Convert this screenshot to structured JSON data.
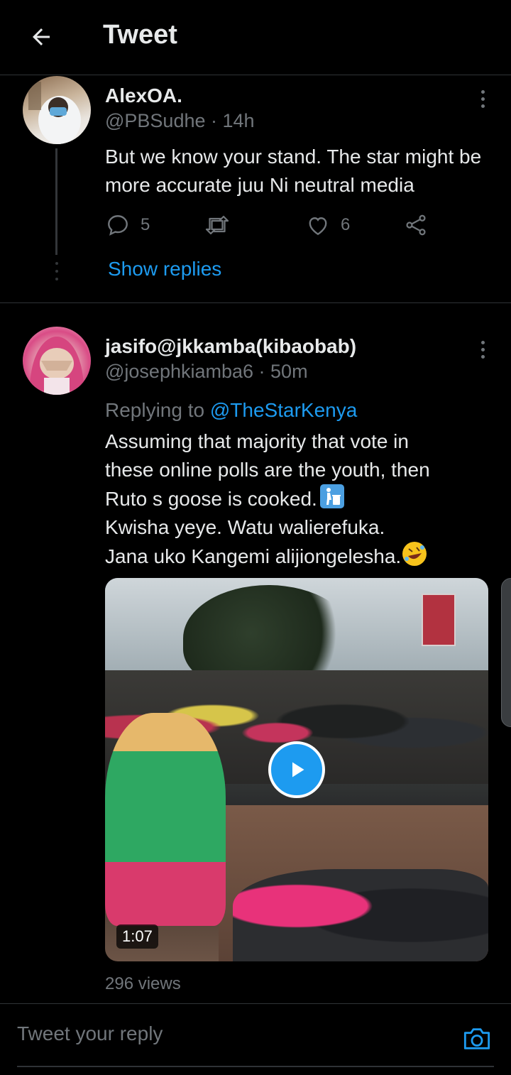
{
  "header": {
    "title": "Tweet",
    "back_icon": "arrow-left-icon"
  },
  "tweets": [
    {
      "name": "AlexOA.",
      "handle": "@PBSudhe",
      "time": "· 14h",
      "text": "But we know your stand. The star might be more accurate juu Ni neutral media",
      "stats": {
        "replies": "5",
        "retweets": "",
        "likes": "6"
      },
      "show_replies": "Show replies"
    },
    {
      "name": "jasifo@jkkamba(kibaobab)",
      "handle": "@josephkiamba6",
      "time": "· 50m",
      "replying_prefix": "Replying to ",
      "replying_to": "@TheStarKenya",
      "lines": [
        "Assuming that majority that vote in",
        "these online polls are the youth, then",
        "Ruto s goose is cooked.",
        "Kwisha yeye. Watu walierefuka.",
        "Jana uko Kangemi alijiongelesha."
      ],
      "emojis": [
        "put-litter-in-its-place-emoji",
        "rolling-on-floor-laughing-emoji"
      ],
      "video": {
        "duration": "1:07"
      },
      "views": "296 views"
    }
  ],
  "reply_bar": {
    "placeholder": "Tweet your reply",
    "camera_icon": "camera-icon"
  },
  "colors": {
    "accent": "#1d9bf0",
    "background": "#000000",
    "muted": "#71767b"
  }
}
